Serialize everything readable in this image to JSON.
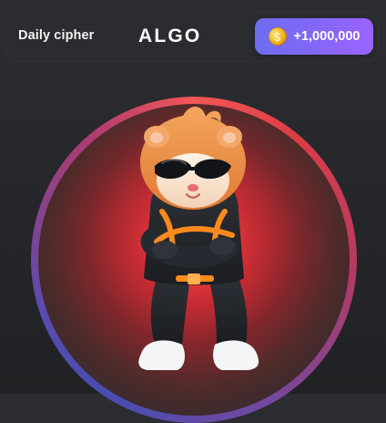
{
  "header": {
    "cipher_label": "Daily cipher",
    "cipher_word": "ALGO",
    "reward": {
      "coin_icon": "coin-icon",
      "text": "+1,000,000"
    }
  },
  "theme": {
    "accent_start": "#6c6cf0",
    "accent_end": "#9a63ff",
    "ring_red": "#ff5a5a",
    "ring_blue": "#4b4fb8"
  },
  "hero": {
    "icon": "hamster-mascot"
  }
}
